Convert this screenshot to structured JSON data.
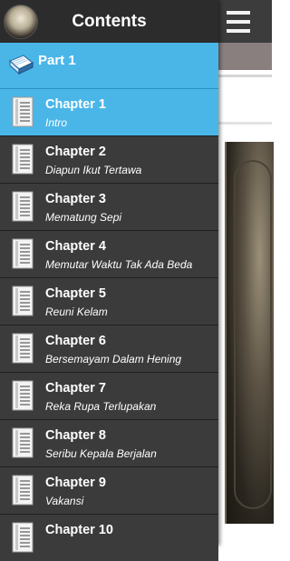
{
  "header": {
    "title": "Contents"
  },
  "part": {
    "label": "Part 1"
  },
  "chapters": [
    {
      "title": "Chapter 1",
      "subtitle": "Intro"
    },
    {
      "title": "Chapter 2",
      "subtitle": "Diapun Ikut Tertawa"
    },
    {
      "title": "Chapter 3",
      "subtitle": "Mematung Sepi"
    },
    {
      "title": "Chapter 4",
      "subtitle": "Memutar Waktu Tak Ada Beda"
    },
    {
      "title": "Chapter 5",
      "subtitle": "Reuni Kelam"
    },
    {
      "title": "Chapter 6",
      "subtitle": "Bersemayam Dalam Hening"
    },
    {
      "title": "Chapter 7",
      "subtitle": "Reka Rupa Terlupakan"
    },
    {
      "title": "Chapter 8",
      "subtitle": "Seribu Kepala Berjalan"
    },
    {
      "title": "Chapter 9",
      "subtitle": "Vakansi"
    },
    {
      "title": "Chapter 10",
      "subtitle": ""
    }
  ],
  "icons": {
    "avatar": "app-cover-avatar",
    "menu": "hamburger-menu-icon",
    "book": "book-icon",
    "document": "document-icon"
  },
  "colors": {
    "drawer_bg": "#3b3b3b",
    "header_bg": "#2c2c2c",
    "accent": "#4ab6e8"
  }
}
